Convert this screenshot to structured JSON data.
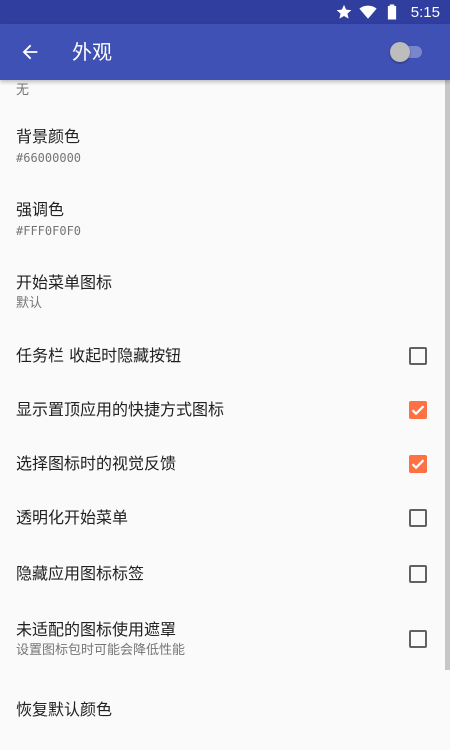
{
  "status_bar": {
    "time": "5:15",
    "icons": [
      "star-icon",
      "wifi-icon",
      "battery-icon"
    ]
  },
  "app_bar": {
    "title": "外观",
    "back_icon": "arrow-back-icon",
    "switch_on": false
  },
  "settings": [
    {
      "id": "partial-top",
      "summary": "无"
    },
    {
      "id": "background-color",
      "title": "背景颜色",
      "summary": "#66000000"
    },
    {
      "id": "accent-color",
      "title": "强调色",
      "summary": "#FFF0F0F0"
    },
    {
      "id": "start-menu-icon",
      "title": "开始菜单图标",
      "summary": "默认"
    },
    {
      "id": "taskbar-hide-buttons",
      "title": "任务栏 收起时隐藏按钮",
      "checked": false
    },
    {
      "id": "show-pinned-shortcut-icons",
      "title": "显示置顶应用的快捷方式图标",
      "checked": true
    },
    {
      "id": "visual-feedback",
      "title": "选择图标时的视觉反馈",
      "checked": true
    },
    {
      "id": "transparent-start-menu",
      "title": "透明化开始菜单",
      "checked": false
    },
    {
      "id": "hide-app-labels",
      "title": "隐藏应用图标标签",
      "checked": false
    },
    {
      "id": "mask-unadapted-icons",
      "title": "未适配的图标使用遮罩",
      "summary": "设置图标包时可能会降低性能",
      "checked": false
    },
    {
      "id": "restore-default-colors",
      "title": "恢复默认颜色"
    }
  ],
  "colors": {
    "status_bar": "#303f9f",
    "app_bar": "#3f51b5",
    "accent": "#ff7043",
    "background": "#fafafa"
  }
}
